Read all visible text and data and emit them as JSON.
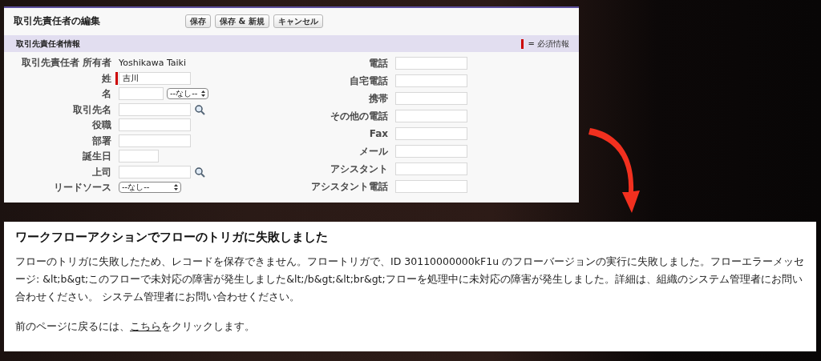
{
  "edit_form": {
    "title": "取引先責任者の編集",
    "buttons": [
      "保存",
      "保存 & 新規",
      "キャンセル"
    ],
    "section": {
      "title": "取引先責任者情報",
      "required_legend": "= 必須情報"
    },
    "left_fields": [
      {
        "label": "取引先責任者 所有者",
        "kind": "text",
        "value": "Yoshikawa Taiki",
        "required": false
      },
      {
        "label": "姓",
        "kind": "input",
        "value": "吉川",
        "required": true
      },
      {
        "label": "名",
        "kind": "input-select",
        "select": "--なし--",
        "required": false
      },
      {
        "label": "取引先名",
        "kind": "lookup",
        "required": false
      },
      {
        "label": "役職",
        "kind": "input",
        "required": false
      },
      {
        "label": "部署",
        "kind": "input",
        "required": false
      },
      {
        "label": "誕生日",
        "kind": "date",
        "required": false
      },
      {
        "label": "上司",
        "kind": "lookup",
        "required": false
      },
      {
        "label": "リードソース",
        "kind": "select",
        "select": "--なし--",
        "required": false
      }
    ],
    "right_fields": [
      {
        "label": "電話"
      },
      {
        "label": "自宅電話"
      },
      {
        "label": "携帯"
      },
      {
        "label": "その他の電話"
      },
      {
        "label": "Fax"
      },
      {
        "label": "メール"
      },
      {
        "label": "アシスタント"
      },
      {
        "label": "アシスタント電話"
      }
    ]
  },
  "error": {
    "title": "ワークフローアクションでフローのトリガに失敗しました",
    "message": "フローのトリガに失敗したため、レコードを保存できません。フロートリガで、ID 30110000000kF1u のフローバージョンの実行に失敗しました。フローエラーメッセージ: &lt;b&gt;このフローで未対応の障害が発生しました&lt;/b&gt;&lt;br&gt;フローを処理中に未対応の障害が発生しました。詳細は、組織のシステム管理者にお問い合わせください。 システム管理者にお問い合わせください。",
    "back_prefix": "前のページに戻るには、",
    "back_link": "こちら",
    "back_suffix": "をクリックします。"
  }
}
